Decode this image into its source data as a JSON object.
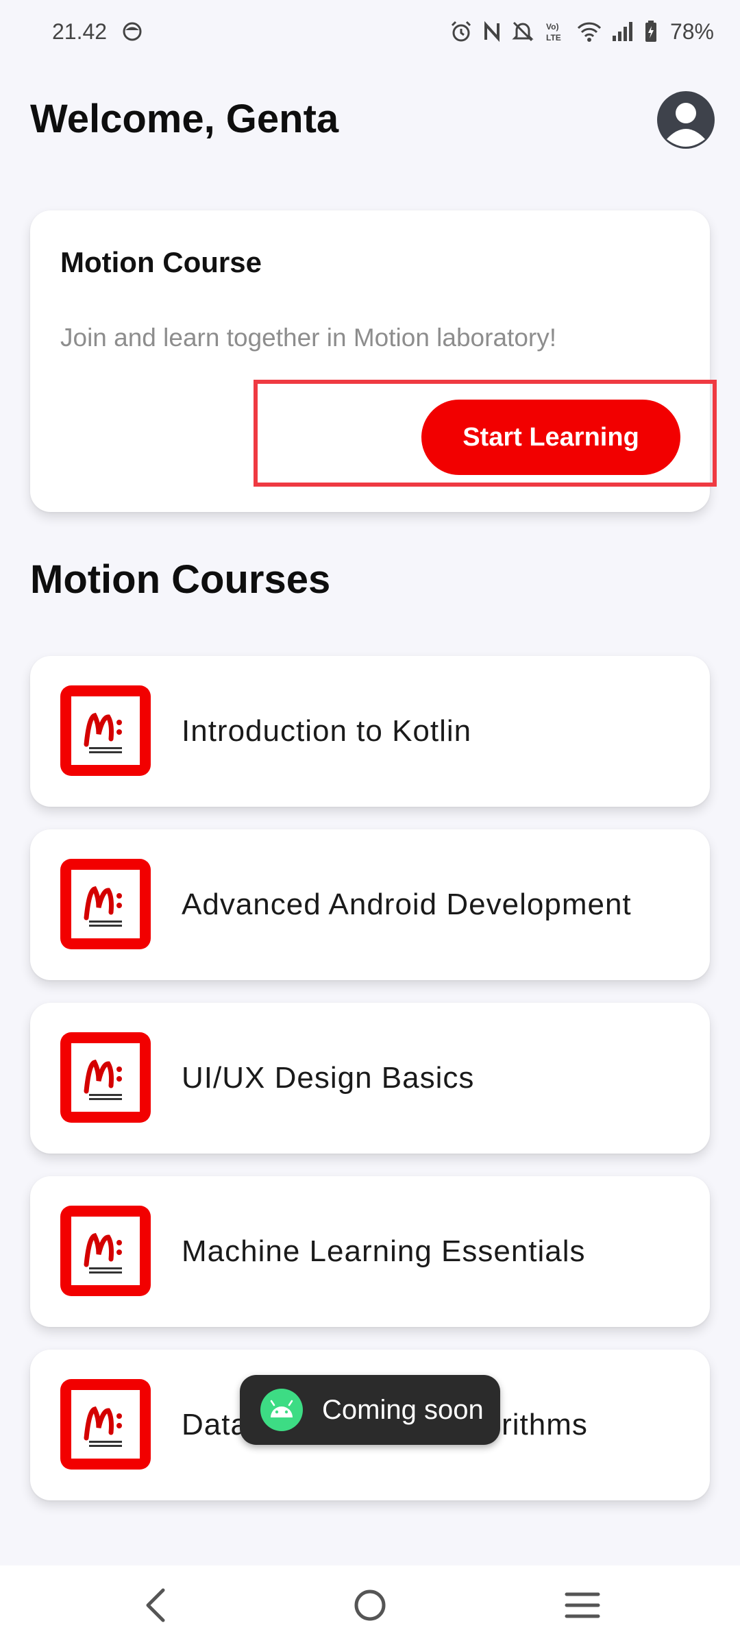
{
  "status_bar": {
    "time": "21.42",
    "battery": "78%",
    "icons": [
      "face-icon",
      "alarm-icon",
      "nfc-icon",
      "mute-icon",
      "volte-icon",
      "wifi-icon",
      "signal-icon",
      "battery-icon"
    ]
  },
  "header": {
    "welcome": "Welcome, Genta",
    "profile_icon": "account-circle-icon"
  },
  "hero": {
    "title": "Motion Course",
    "subtitle": "Join and learn together in Motion laboratory!",
    "button_label": "Start Learning",
    "button_color": "#f20000"
  },
  "courses": {
    "section_title": "Motion Courses",
    "items": [
      {
        "name": "Introduction to Kotlin"
      },
      {
        "name": "Advanced Android Development"
      },
      {
        "name": "UI/UX Design Basics"
      },
      {
        "name": "Machine Learning Essentials"
      },
      {
        "name": "Data Structures & Algorithms"
      }
    ]
  },
  "toast": {
    "text": "Coming soon"
  },
  "nav": {
    "back_icon": "back-icon",
    "home_icon": "home-icon",
    "recents_icon": "recents-icon"
  }
}
